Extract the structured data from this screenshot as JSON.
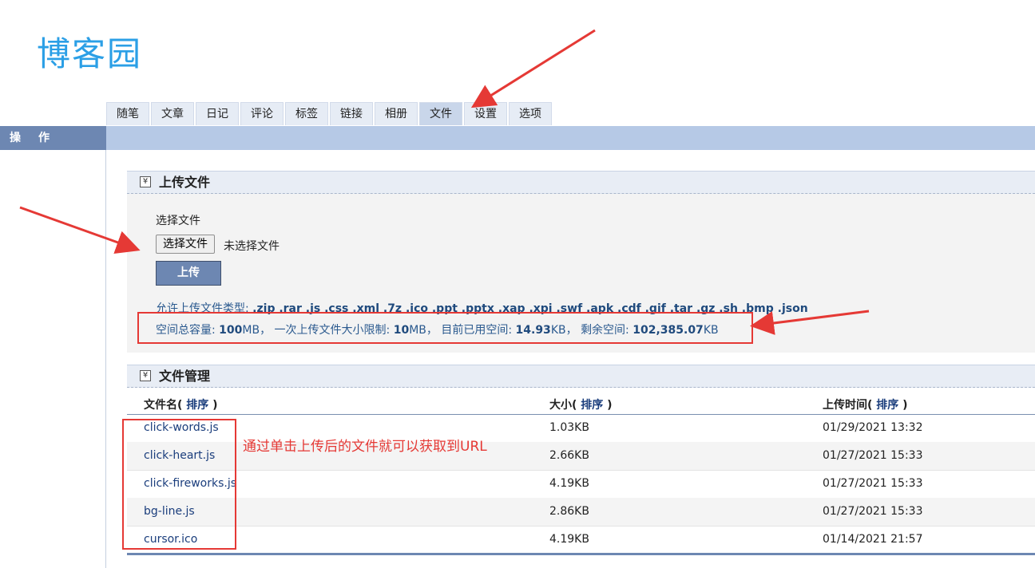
{
  "logo": {
    "text": "博客园",
    "brand_color": "#2b9fe6",
    "accent_color": "#f5a623"
  },
  "tabs": [
    {
      "label": "随笔",
      "active": false
    },
    {
      "label": "文章",
      "active": false
    },
    {
      "label": "日记",
      "active": false
    },
    {
      "label": "评论",
      "active": false
    },
    {
      "label": "标签",
      "active": false
    },
    {
      "label": "链接",
      "active": false
    },
    {
      "label": "相册",
      "active": false
    },
    {
      "label": "文件",
      "active": true
    },
    {
      "label": "设置",
      "active": false
    },
    {
      "label": "选项",
      "active": false
    }
  ],
  "sidebar": {
    "title": "操作"
  },
  "upload": {
    "title": "上传文件",
    "choose_label": "选择文件",
    "choose_button": "选择文件",
    "no_file": "未选择文件",
    "upload_button": "上传",
    "types_prefix": "允许上传文件类型: ",
    "types": ".zip .rar .js .css .xml .7z .ico .ppt .pptx .xap .xpi .swf .apk .cdf .gif .tar .gz .sh .bmp .json",
    "quota": {
      "total_label": "空间总容量: ",
      "total_value": "100",
      "total_unit": "MB， ",
      "limit_label": "一次上传文件大小限制: ",
      "limit_value": "10",
      "limit_unit": "MB， ",
      "used_label": "目前已用空间: ",
      "used_value": "14.93",
      "used_unit": "KB， ",
      "free_label": "剩余空间: ",
      "free_value": "102,385.07",
      "free_unit": "KB"
    }
  },
  "files": {
    "title": "文件管理",
    "headers": {
      "name": "文件名(",
      "size": "大小(",
      "time": "上传时间(",
      "sort": " 排序 ",
      "close": ")"
    },
    "rows": [
      {
        "name": "click-words.js",
        "size": "1.03KB",
        "time": "01/29/2021 13:32"
      },
      {
        "name": "click-heart.js",
        "size": "2.66KB",
        "time": "01/27/2021 15:33"
      },
      {
        "name": "click-fireworks.js",
        "size": "4.19KB",
        "time": "01/27/2021 15:33"
      },
      {
        "name": "bg-line.js",
        "size": "2.86KB",
        "time": "01/27/2021 15:33"
      },
      {
        "name": "cursor.ico",
        "size": "4.19KB",
        "time": "01/14/2021 21:57"
      }
    ]
  },
  "annotation": {
    "text": "通过单击上传后的文件就可以获取到URL",
    "color": "#e53935"
  }
}
